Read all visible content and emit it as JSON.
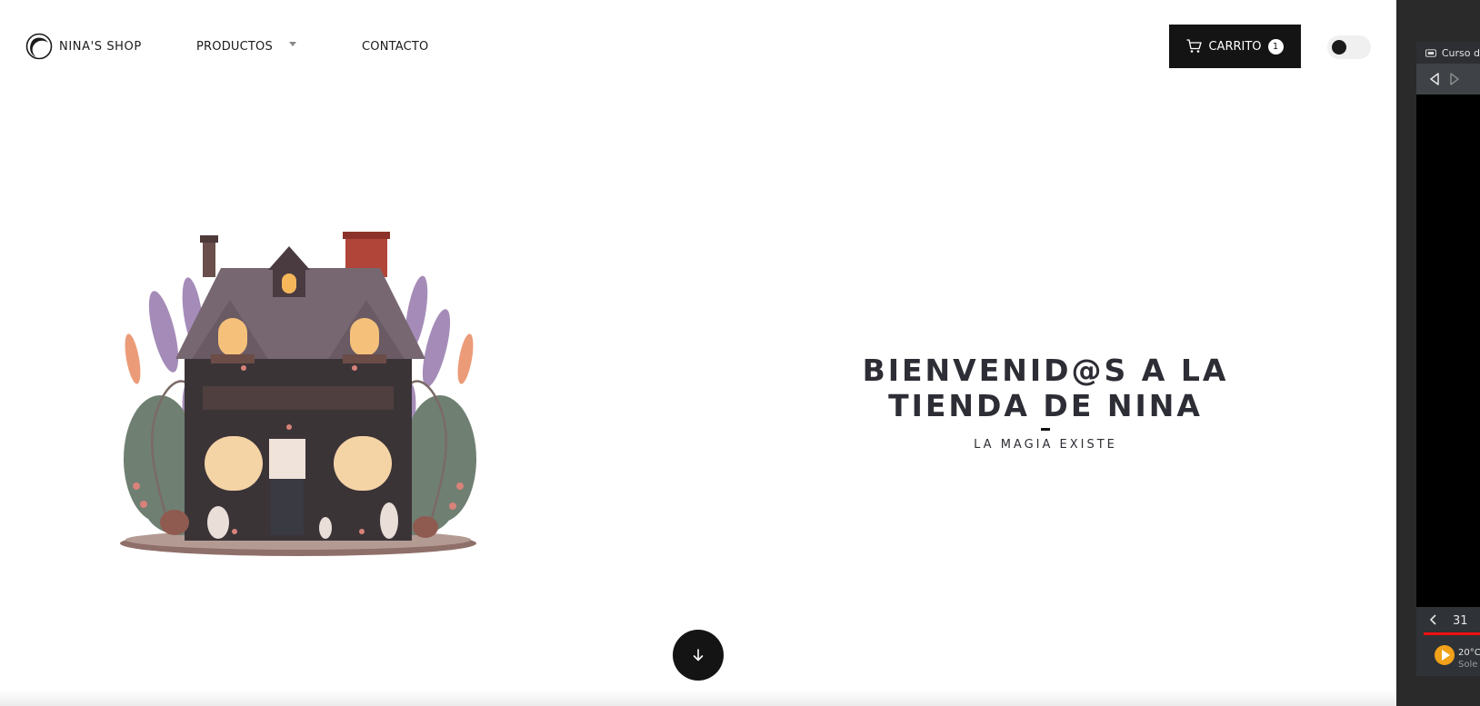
{
  "brand": {
    "name": "NINA'S SHOP"
  },
  "nav": {
    "products_label": "PRODUCTOS",
    "contact_label": "CONTACTO"
  },
  "cart": {
    "label": "CARRITO",
    "count": "1"
  },
  "theme_toggle": {
    "state": "light"
  },
  "hero": {
    "title_line1": "BIENVENID@S A LA",
    "title_line2": "TIENDA DE NINA",
    "subtitle": "LA MAGIA EXISTE"
  },
  "side_panel": {
    "title": "Curso d",
    "calendar_day": "31",
    "weather_temp": "20°C",
    "weather_desc": "Sole"
  },
  "colors": {
    "accent_dark": "#141414",
    "title_text": "#2d2d35",
    "background": "#ffffff"
  }
}
